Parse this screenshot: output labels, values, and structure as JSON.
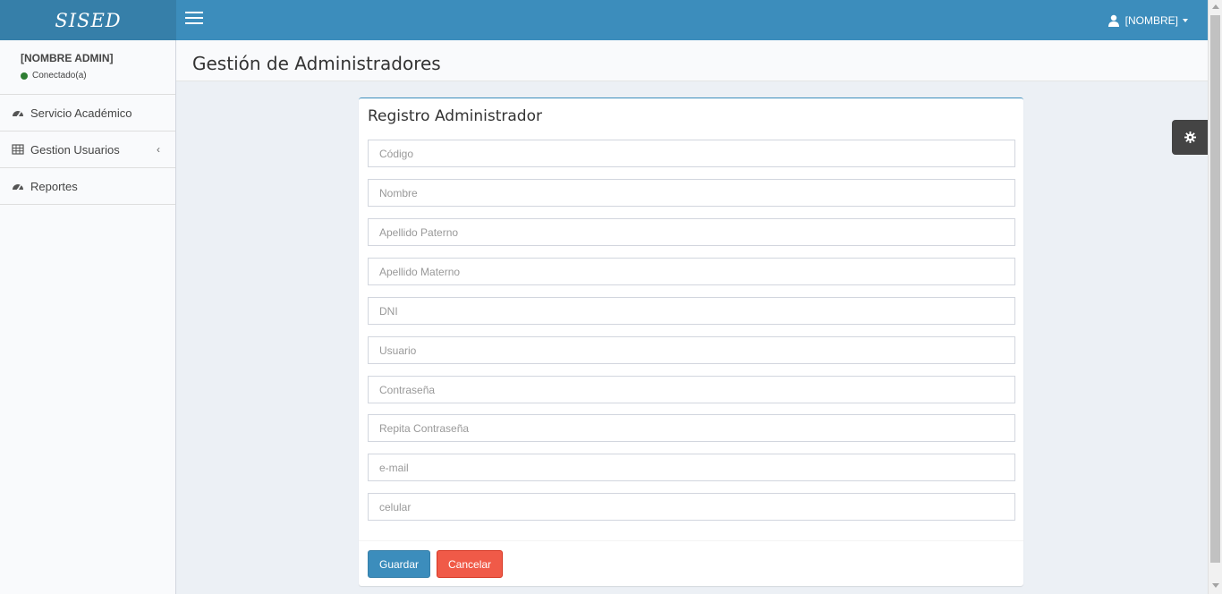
{
  "app": {
    "logo": "SISED"
  },
  "header": {
    "user_label": "[NOMBRE]"
  },
  "sidebar": {
    "admin_name": "[NOMBRE ADMIN]",
    "status": "Conectado(a)",
    "items": [
      {
        "label": "Servicio Académico",
        "icon": "dashboard-icon"
      },
      {
        "label": "Gestion Usuarios",
        "icon": "table-icon"
      },
      {
        "label": "Reportes",
        "icon": "dashboard-icon"
      }
    ]
  },
  "page": {
    "title": "Gestión de Administradores"
  },
  "form": {
    "title": "Registro Administrador",
    "fields": {
      "codigo": "Código",
      "nombre": "Nombre",
      "apellido_paterno": "Apellido Paterno",
      "apellido_materno": "Apellido Materno",
      "dni": "DNI",
      "usuario": "Usuario",
      "contrasena": "Contraseña",
      "repita_contrasena": "Repita Contraseña",
      "email": "e-mail",
      "celular": "celular"
    },
    "save_label": "Guardar",
    "cancel_label": "Cancelar"
  },
  "colors": {
    "primary": "#3c8dbc",
    "danger": "#f05a48",
    "status_online": "#2e7d32"
  }
}
